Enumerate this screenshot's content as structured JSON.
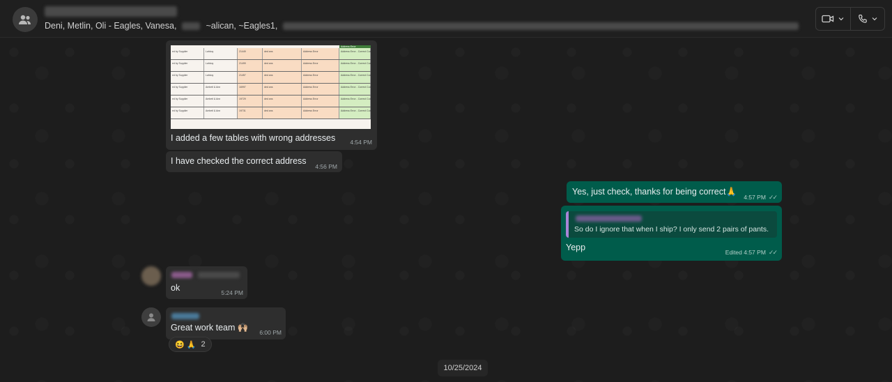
{
  "header": {
    "title": "",
    "participants_visible": [
      "Deni, Metlin, Oli - Eagles, Vanesa,",
      "~alican, ~Eagles1,"
    ],
    "video_icon": "video-call-icon",
    "call_icon": "phone-call-icon"
  },
  "messages": [
    {
      "type": "image-caption",
      "text": "I added a few tables with wrong addresses",
      "time": "4:54 PM"
    },
    {
      "type": "text",
      "text": "I have checked the correct address",
      "time": "4:56 PM"
    },
    {
      "type": "outgoing",
      "text": "Yes, just check, thanks for being correct🙏",
      "time": "4:57 PM"
    },
    {
      "type": "outgoing-reply",
      "quoted": "So do I ignore that when I ship? I only send 2 pairs of pants.",
      "text": "Yepp",
      "time": "Edited 4:57 PM"
    },
    {
      "type": "text",
      "text": "ok",
      "time": "5:24 PM"
    },
    {
      "type": "text",
      "text": "Great work team 🙌🏼",
      "time": "6:00 PM",
      "reactions": "😆 🙏",
      "reaction_count": "2"
    }
  ],
  "sheet": {
    "header_cell": "Address Error",
    "rows": [
      [
        "ed by Supplier",
        "Lahkoy",
        "21449",
        "ded ans",
        "Address Error",
        "Address Error - Correct Customer"
      ],
      [
        "ed by Supplier",
        "Lahkoy",
        "21499",
        "ded ans",
        "Address Error",
        "Address Error - Correct Customer"
      ],
      [
        "ed by Supplier",
        "Lahkoy",
        "21457",
        "ded ans",
        "Address Error",
        "Address Error - Correct Customer"
      ],
      [
        "ed by Supplier",
        "Ambeti & Ann",
        "16997",
        "ded ans",
        "Address Error",
        "Address Error - Correct Customer"
      ],
      [
        "ed by Supplier",
        "Ambeti & Ann",
        "19729",
        "ded ans",
        "Address Error",
        "Address Error - Correct Customer"
      ],
      [
        "ed by Supplier",
        "Ambeti & Ann",
        "19731",
        "ded ans",
        "Address Error",
        "Address Error - Correct Customer"
      ]
    ]
  },
  "date_chip": "10/25/2024",
  "colors": {
    "outgoing": "#005c4b",
    "incoming": "#2e2e2e",
    "background": "#1d1d1d"
  }
}
